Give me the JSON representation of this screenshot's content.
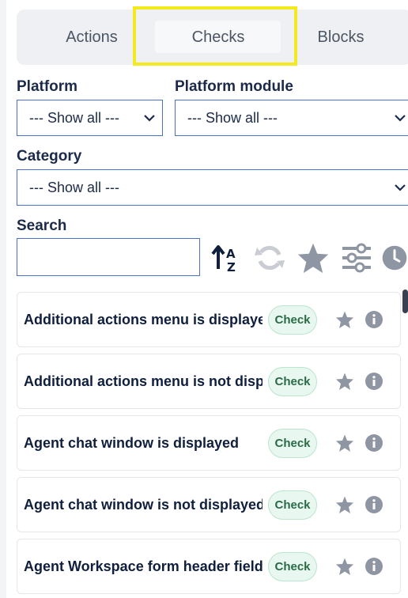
{
  "tabs": [
    {
      "label": "Actions"
    },
    {
      "label": "Checks",
      "active": true
    },
    {
      "label": "Blocks"
    }
  ],
  "filters": {
    "platform_label": "Platform",
    "platform_value": "--- Show all ---",
    "module_label": "Platform module",
    "module_value": "--- Show all ---",
    "category_label": "Category",
    "category_value": "--- Show all ---"
  },
  "search": {
    "label": "Search",
    "value": "",
    "placeholder": ""
  },
  "toolbar": {
    "icons": [
      "sort-az-icon",
      "refresh-icon",
      "star-icon",
      "sliders-icon",
      "clock-icon"
    ]
  },
  "items": [
    {
      "title": "Additional actions menu is displayed",
      "badge": "Check"
    },
    {
      "title": "Additional actions menu is not displ...",
      "badge": "Check"
    },
    {
      "title": "Agent chat window is displayed",
      "badge": "Check"
    },
    {
      "title": "Agent chat window is not displayed",
      "badge": "Check"
    },
    {
      "title": "Agent Workspace form header field...",
      "badge": "Check"
    }
  ],
  "colors": {
    "highlight": "#f2ea1f",
    "badge_bg": "#e8f7ef",
    "badge_text": "#2a6b47",
    "icon_gray": "#9aa1ad",
    "navy": "#0f1f3d"
  }
}
